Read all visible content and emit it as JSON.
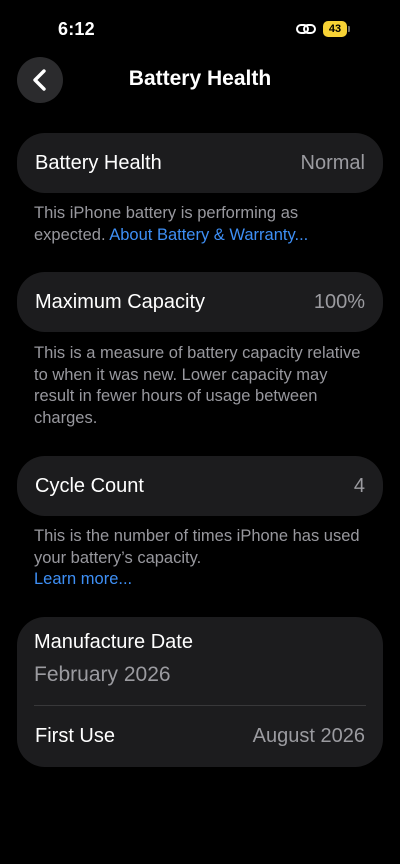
{
  "status_bar": {
    "time": "6:12",
    "battery_level": "43",
    "battery_color": "#f7d235"
  },
  "nav": {
    "title": "Battery Health",
    "back_icon": "chevron-left-icon"
  },
  "battery_health": {
    "label": "Battery Health",
    "value": "Normal",
    "footnote_text": "This iPhone battery is performing as expected.",
    "footnote_link": "About Battery & Warranty..."
  },
  "maximum_capacity": {
    "label": "Maximum Capacity",
    "value": "100%",
    "footnote_text": "This is a measure of battery capacity relative to when it was new. Lower capacity may result in fewer hours of usage between charges."
  },
  "cycle_count": {
    "label": "Cycle Count",
    "value": "4",
    "footnote_text": "This is the number of times iPhone has used your battery’s capacity.",
    "footnote_link": "Learn more..."
  },
  "dates": {
    "manufacture_label": "Manufacture Date",
    "manufacture_value": "February 2026",
    "first_use_label": "First Use",
    "first_use_value": "August 2026"
  },
  "colors": {
    "link": "#3e8ff5",
    "card": "#1c1c1e",
    "secondary_text": "#98989e"
  }
}
